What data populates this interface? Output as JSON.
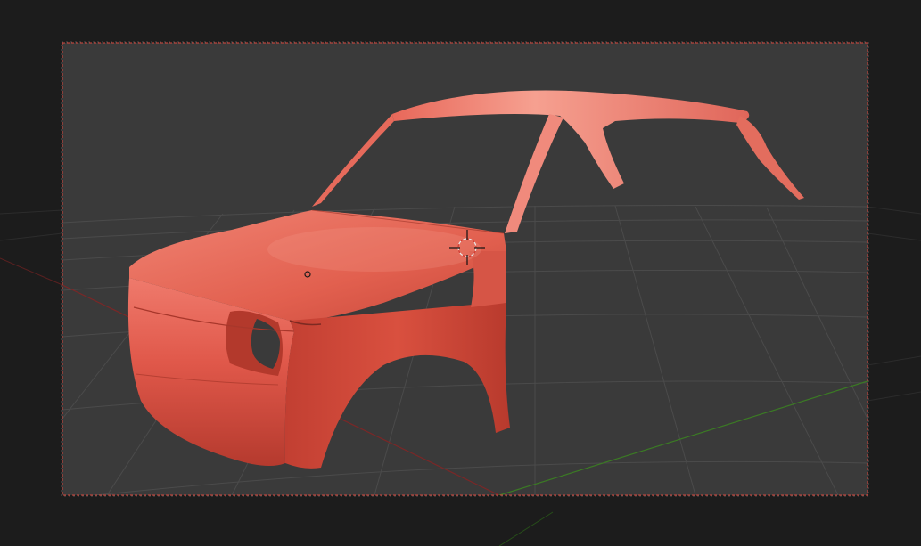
{
  "viewport": {
    "mode": "camera-view",
    "object": "car-body-shell",
    "colors": {
      "outer_background": "#1c1c1c",
      "camera_frame_fill": "#3a3a3a",
      "camera_frame_border": "#d9473c",
      "grid_line": "#4a4a4a",
      "x_axis": "#8a2b2b",
      "y_axis": "#3b7a24",
      "body_paint": "#e0584a",
      "body_shadow": "#a93227",
      "body_highlight": "#f08a7c"
    },
    "icons": [
      "3d-cursor-icon",
      "object-origin-icon"
    ]
  }
}
